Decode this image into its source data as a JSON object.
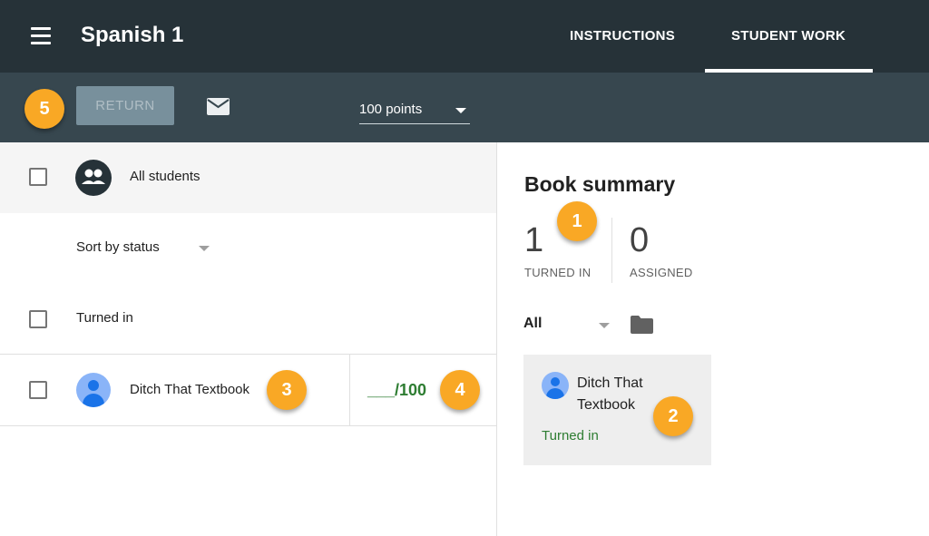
{
  "header": {
    "title": "Spanish 1",
    "tabs": [
      {
        "label": "INSTRUCTIONS",
        "active": false
      },
      {
        "label": "STUDENT WORK",
        "active": true
      }
    ]
  },
  "toolbar": {
    "return_label": "RETURN",
    "points_value": "100 points",
    "icons": [
      "menu-icon",
      "mail-icon",
      "chevron-down-icon"
    ]
  },
  "list": {
    "all_students_label": "All students",
    "sort_label": "Sort by status",
    "section_label": "Turned in",
    "students": [
      {
        "name": "Ditch That Textbook",
        "grade": "___/100"
      }
    ]
  },
  "summary": {
    "title": "Book summary",
    "turned_in_count": "1",
    "turned_in_label": "TURNED IN",
    "assigned_count": "0",
    "assigned_label": "ASSIGNED",
    "filter_value": "All",
    "card": {
      "name": "Ditch That Textbook",
      "status": "Turned in"
    }
  },
  "callouts": [
    "1",
    "2",
    "3",
    "4",
    "5"
  ],
  "colors": {
    "header_bg": "#263238",
    "toolbar_bg": "#37474f",
    "callout": "#f9a825",
    "turned_in_green": "#2e7d32"
  }
}
